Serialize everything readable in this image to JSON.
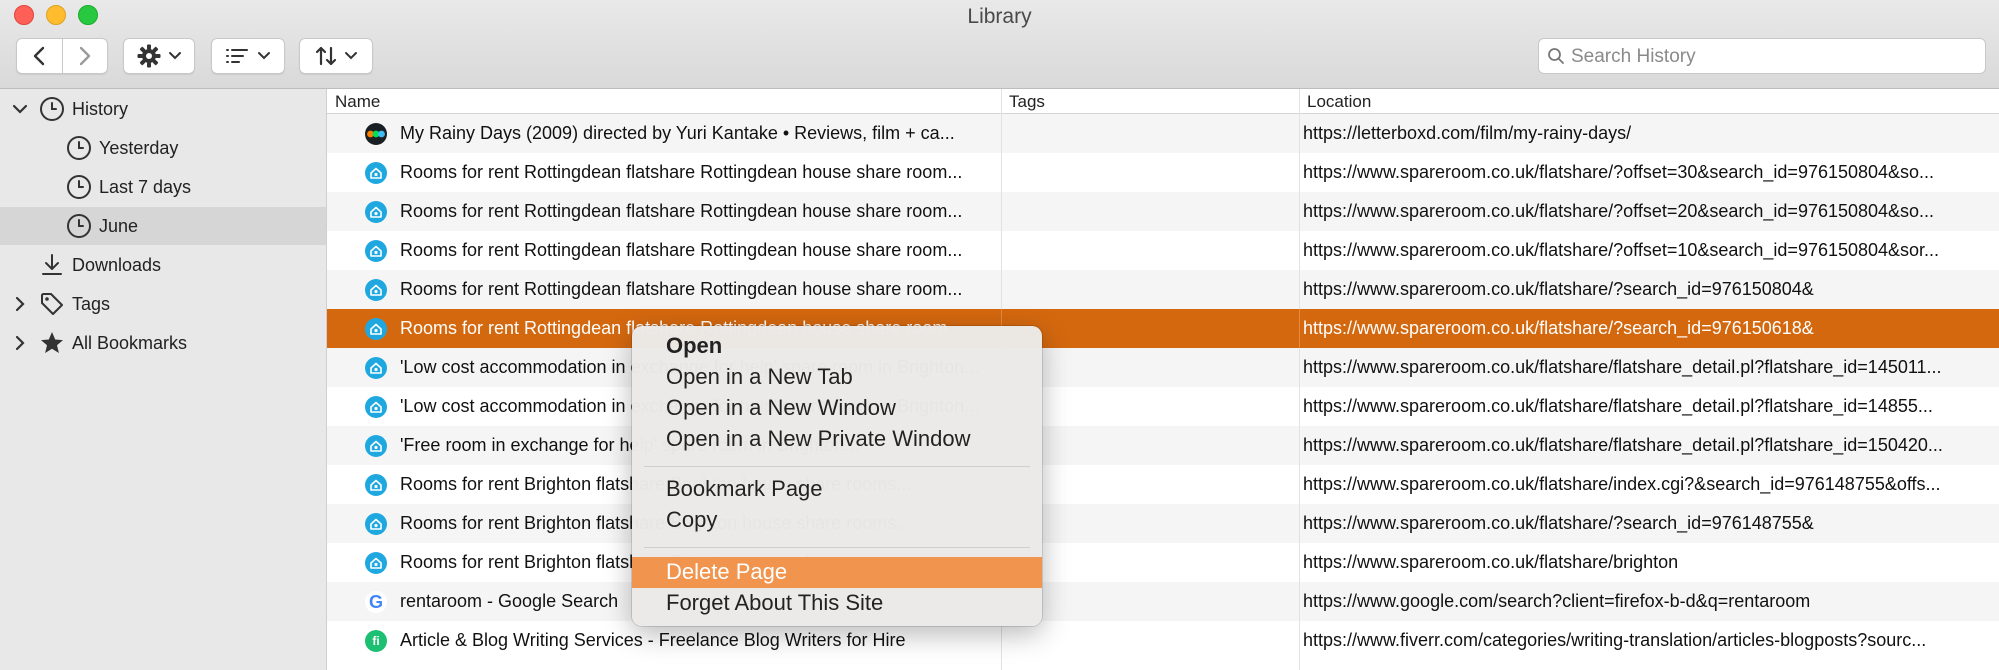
{
  "window": {
    "title": "Library"
  },
  "toolbar": {
    "back_icon": "chevron-left-icon",
    "forward_icon": "chevron-right-icon",
    "organize_icon": "gear-icon",
    "views_icon": "list-icon",
    "import_backup_icon": "sort-arrows-icon",
    "search_placeholder": "Search History",
    "search_value": ""
  },
  "sidebar": {
    "items": [
      {
        "label": "History",
        "icon": "clock-icon",
        "expanded": true
      },
      {
        "label": "Yesterday",
        "icon": "clock-icon"
      },
      {
        "label": "Last 7 days",
        "icon": "clock-icon"
      },
      {
        "label": "June",
        "icon": "clock-icon",
        "selected": true
      },
      {
        "label": "Downloads",
        "icon": "download-icon"
      },
      {
        "label": "Tags",
        "icon": "tag-icon",
        "expanded": false
      },
      {
        "label": "All Bookmarks",
        "icon": "star-icon",
        "expanded": false
      }
    ]
  },
  "table": {
    "columns": [
      "Name",
      "Tags",
      "Location"
    ],
    "rows": [
      {
        "icon": "letterboxd-icon",
        "name": "My Rainy Days (2009) directed by Yuri Kantake • Reviews, film + ca...",
        "tags": "",
        "location": "https://letterboxd.com/film/my-rainy-days/"
      },
      {
        "icon": "spareroom-icon",
        "name": "Rooms for rent Rottingdean flatshare Rottingdean house share room...",
        "tags": "",
        "location": "https://www.spareroom.co.uk/flatshare/?offset=30&search_id=976150804&so..."
      },
      {
        "icon": "spareroom-icon",
        "name": "Rooms for rent Rottingdean flatshare Rottingdean house share room...",
        "tags": "",
        "location": "https://www.spareroom.co.uk/flatshare/?offset=20&search_id=976150804&so..."
      },
      {
        "icon": "spareroom-icon",
        "name": "Rooms for rent Rottingdean flatshare Rottingdean house share room...",
        "tags": "",
        "location": "https://www.spareroom.co.uk/flatshare/?offset=10&search_id=976150804&sor..."
      },
      {
        "icon": "spareroom-icon",
        "name": "Rooms for rent Rottingdean flatshare Rottingdean house share room...",
        "tags": "",
        "location": "https://www.spareroom.co.uk/flatshare/?search_id=976150804&"
      },
      {
        "icon": "spareroom-icon",
        "name": "Rooms for rent Rottingdean flatshare Rottingdean house share room...",
        "tags": "",
        "location": "https://www.spareroom.co.uk/flatshare/?search_id=976150618&",
        "selected": true
      },
      {
        "icon": "spareroom-icon",
        "name": "'Low cost accommodation in exchange for help' spare room in Brighton...",
        "tags": "",
        "location": "https://www.spareroom.co.uk/flatshare/flatshare_detail.pl?flatshare_id=145011..."
      },
      {
        "icon": "spareroom-icon",
        "name": "'Low cost accommodation in exchange for help' spare room in Brighton...",
        "tags": "",
        "location": "https://www.spareroom.co.uk/flatshare/flatshare_detail.pl?flatshare_id=14855..."
      },
      {
        "icon": "spareroom-icon",
        "name": "'Free room in exchange for help' spare room in Brighton...",
        "tags": "",
        "location": "https://www.spareroom.co.uk/flatshare/flatshare_detail.pl?flatshare_id=150420..."
      },
      {
        "icon": "spareroom-icon",
        "name": "Rooms for rent Brighton flatshare Brighton house share rooms...",
        "tags": "",
        "location": "https://www.spareroom.co.uk/flatshare/index.cgi?&search_id=976148755&offs..."
      },
      {
        "icon": "spareroom-icon",
        "name": "Rooms for rent Brighton flatshare Brighton house share rooms...",
        "tags": "",
        "location": "https://www.spareroom.co.uk/flatshare/?search_id=976148755&"
      },
      {
        "icon": "spareroom-icon",
        "name": "Rooms for rent Brighton flatshare Brighton house share rooms...",
        "tags": "",
        "location": "https://www.spareroom.co.uk/flatshare/brighton"
      },
      {
        "icon": "google-icon",
        "name": "rentaroom - Google Search",
        "tags": "",
        "location": "https://www.google.com/search?client=firefox-b-d&q=rentaroom"
      },
      {
        "icon": "fiverr-icon",
        "name": "Article & Blog Writing Services - Freelance Blog Writers for Hire",
        "tags": "",
        "location": "https://www.fiverr.com/categories/writing-translation/articles-blogposts?sourc..."
      }
    ]
  },
  "context_menu": {
    "groups": [
      [
        "Open",
        "Open in a New Tab",
        "Open in a New Window",
        "Open in a New Private Window"
      ],
      [
        "Bookmark Page",
        "Copy"
      ],
      [
        "Delete Page",
        "Forget About This Site"
      ]
    ],
    "highlighted": "Delete Page"
  },
  "colors": {
    "selection": "#d4680f",
    "menu_highlight": "#f0944e",
    "spareroom": "#1fa8e0"
  }
}
